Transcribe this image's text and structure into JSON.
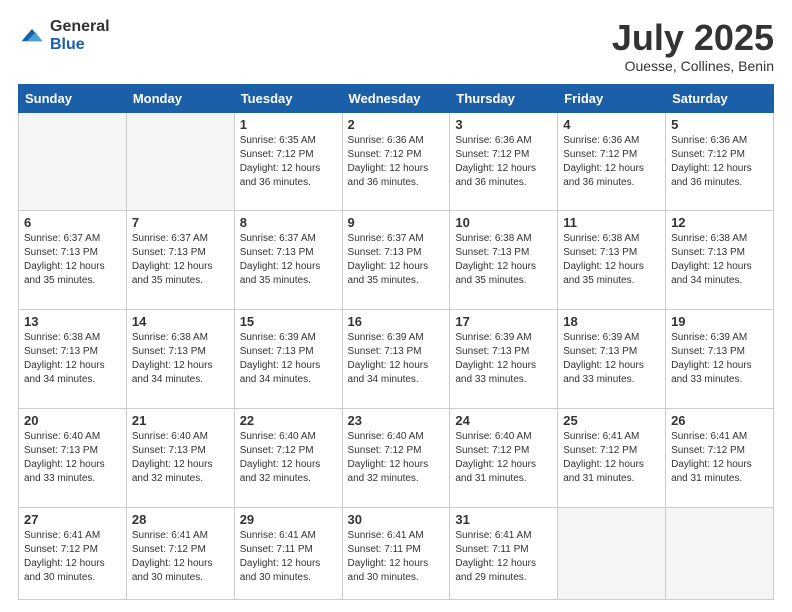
{
  "header": {
    "logo_general": "General",
    "logo_blue": "Blue",
    "title": "July 2025",
    "subtitle": "Ouesse, Collines, Benin"
  },
  "days_of_week": [
    "Sunday",
    "Monday",
    "Tuesday",
    "Wednesday",
    "Thursday",
    "Friday",
    "Saturday"
  ],
  "weeks": [
    [
      {
        "day": "",
        "info": "",
        "empty": true
      },
      {
        "day": "",
        "info": "",
        "empty": true
      },
      {
        "day": "1",
        "info": "Sunrise: 6:35 AM\nSunset: 7:12 PM\nDaylight: 12 hours and 36 minutes."
      },
      {
        "day": "2",
        "info": "Sunrise: 6:36 AM\nSunset: 7:12 PM\nDaylight: 12 hours and 36 minutes."
      },
      {
        "day": "3",
        "info": "Sunrise: 6:36 AM\nSunset: 7:12 PM\nDaylight: 12 hours and 36 minutes."
      },
      {
        "day": "4",
        "info": "Sunrise: 6:36 AM\nSunset: 7:12 PM\nDaylight: 12 hours and 36 minutes."
      },
      {
        "day": "5",
        "info": "Sunrise: 6:36 AM\nSunset: 7:12 PM\nDaylight: 12 hours and 36 minutes."
      }
    ],
    [
      {
        "day": "6",
        "info": "Sunrise: 6:37 AM\nSunset: 7:13 PM\nDaylight: 12 hours and 35 minutes."
      },
      {
        "day": "7",
        "info": "Sunrise: 6:37 AM\nSunset: 7:13 PM\nDaylight: 12 hours and 35 minutes."
      },
      {
        "day": "8",
        "info": "Sunrise: 6:37 AM\nSunset: 7:13 PM\nDaylight: 12 hours and 35 minutes."
      },
      {
        "day": "9",
        "info": "Sunrise: 6:37 AM\nSunset: 7:13 PM\nDaylight: 12 hours and 35 minutes."
      },
      {
        "day": "10",
        "info": "Sunrise: 6:38 AM\nSunset: 7:13 PM\nDaylight: 12 hours and 35 minutes."
      },
      {
        "day": "11",
        "info": "Sunrise: 6:38 AM\nSunset: 7:13 PM\nDaylight: 12 hours and 35 minutes."
      },
      {
        "day": "12",
        "info": "Sunrise: 6:38 AM\nSunset: 7:13 PM\nDaylight: 12 hours and 34 minutes."
      }
    ],
    [
      {
        "day": "13",
        "info": "Sunrise: 6:38 AM\nSunset: 7:13 PM\nDaylight: 12 hours and 34 minutes."
      },
      {
        "day": "14",
        "info": "Sunrise: 6:38 AM\nSunset: 7:13 PM\nDaylight: 12 hours and 34 minutes."
      },
      {
        "day": "15",
        "info": "Sunrise: 6:39 AM\nSunset: 7:13 PM\nDaylight: 12 hours and 34 minutes."
      },
      {
        "day": "16",
        "info": "Sunrise: 6:39 AM\nSunset: 7:13 PM\nDaylight: 12 hours and 34 minutes."
      },
      {
        "day": "17",
        "info": "Sunrise: 6:39 AM\nSunset: 7:13 PM\nDaylight: 12 hours and 33 minutes."
      },
      {
        "day": "18",
        "info": "Sunrise: 6:39 AM\nSunset: 7:13 PM\nDaylight: 12 hours and 33 minutes."
      },
      {
        "day": "19",
        "info": "Sunrise: 6:39 AM\nSunset: 7:13 PM\nDaylight: 12 hours and 33 minutes."
      }
    ],
    [
      {
        "day": "20",
        "info": "Sunrise: 6:40 AM\nSunset: 7:13 PM\nDaylight: 12 hours and 33 minutes."
      },
      {
        "day": "21",
        "info": "Sunrise: 6:40 AM\nSunset: 7:13 PM\nDaylight: 12 hours and 32 minutes."
      },
      {
        "day": "22",
        "info": "Sunrise: 6:40 AM\nSunset: 7:12 PM\nDaylight: 12 hours and 32 minutes."
      },
      {
        "day": "23",
        "info": "Sunrise: 6:40 AM\nSunset: 7:12 PM\nDaylight: 12 hours and 32 minutes."
      },
      {
        "day": "24",
        "info": "Sunrise: 6:40 AM\nSunset: 7:12 PM\nDaylight: 12 hours and 31 minutes."
      },
      {
        "day": "25",
        "info": "Sunrise: 6:41 AM\nSunset: 7:12 PM\nDaylight: 12 hours and 31 minutes."
      },
      {
        "day": "26",
        "info": "Sunrise: 6:41 AM\nSunset: 7:12 PM\nDaylight: 12 hours and 31 minutes."
      }
    ],
    [
      {
        "day": "27",
        "info": "Sunrise: 6:41 AM\nSunset: 7:12 PM\nDaylight: 12 hours and 30 minutes."
      },
      {
        "day": "28",
        "info": "Sunrise: 6:41 AM\nSunset: 7:12 PM\nDaylight: 12 hours and 30 minutes."
      },
      {
        "day": "29",
        "info": "Sunrise: 6:41 AM\nSunset: 7:11 PM\nDaylight: 12 hours and 30 minutes."
      },
      {
        "day": "30",
        "info": "Sunrise: 6:41 AM\nSunset: 7:11 PM\nDaylight: 12 hours and 30 minutes."
      },
      {
        "day": "31",
        "info": "Sunrise: 6:41 AM\nSunset: 7:11 PM\nDaylight: 12 hours and 29 minutes."
      },
      {
        "day": "",
        "info": "",
        "empty": true
      },
      {
        "day": "",
        "info": "",
        "empty": true
      }
    ]
  ]
}
